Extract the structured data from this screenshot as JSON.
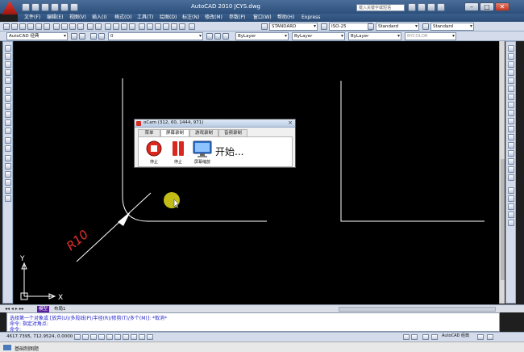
{
  "window": {
    "title": "AutoCAD 2010    JCYS.dwg",
    "search_placeholder": "键入关键字或短语",
    "controls": {
      "minimize": "–",
      "maximize": "□",
      "close": "✕"
    }
  },
  "menu": {
    "items": [
      "文件(F)",
      "编辑(E)",
      "视图(V)",
      "插入(I)",
      "格式(O)",
      "工具(T)",
      "绘图(D)",
      "标注(N)",
      "修改(M)",
      "参数(P)",
      "窗口(W)",
      "帮助(H)",
      "Express"
    ]
  },
  "toolbar": {
    "text_style": "STANDARD",
    "dim_style": "ISO-25",
    "table_style": "Standard",
    "mleader_style": "Standard",
    "workspace": "AutoCAD 经典",
    "layer": "0",
    "color": "ByLayer",
    "linetype": "ByLayer",
    "lineweight": "ByLayer",
    "plotstyle": "BYCOLOR"
  },
  "drawing": {
    "annotation": "R10",
    "ucs_x": "X",
    "ucs_y": "Y"
  },
  "tabs": {
    "model": "模型",
    "layout1": "布局1"
  },
  "command": {
    "line1": "选择第一个对象或 [放弃(U)/多段线(P)/半径(R)/修剪(T)/多个(M)]: *取消*",
    "line2": "命令: 指定对角点:",
    "line3": "命令:"
  },
  "status": {
    "coordinates": "4617.7395, 712.9524, 0.0000",
    "workspace": "AutoCAD 经典"
  },
  "bottom": {
    "text": "基础制图题"
  },
  "ocam": {
    "title": "oCam (312, 60, 1444, 971)",
    "tabs": [
      "菜单",
      "屏幕录制",
      "游戏录制",
      "音频录制"
    ],
    "active_tab": 1,
    "buttons": {
      "stop": "停止",
      "pause": "停止",
      "screen": "屏幕缩放"
    },
    "start": "开始..."
  },
  "colors": {
    "canvas": "#000000",
    "line": "#ffffff",
    "annotation": "#e8302a",
    "highlight": "#ffff00"
  }
}
